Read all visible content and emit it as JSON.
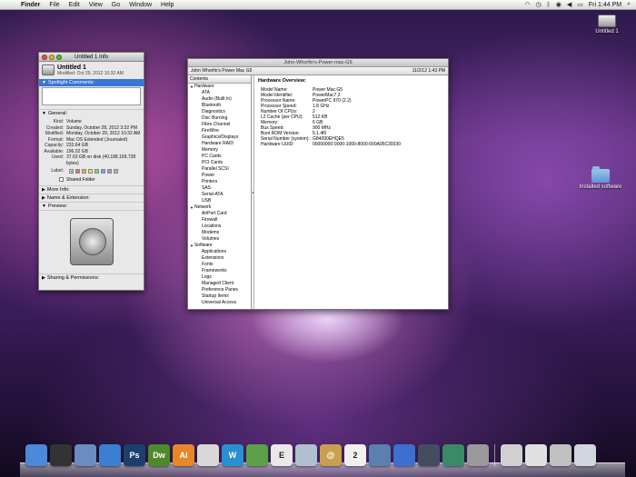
{
  "menubar": {
    "apple": "",
    "items": [
      "Finder",
      "File",
      "Edit",
      "View",
      "Go",
      "Window",
      "Help"
    ],
    "clock": "Fri 1:44 PM"
  },
  "desktop": {
    "icons": [
      {
        "label": "Untitled 1"
      },
      {
        "label": "Installed software"
      }
    ]
  },
  "info_window": {
    "title": "Untitled 1 Info",
    "name": "Untitled 1",
    "modified_line": "Modified: Oct 29, 2012 10:32 AM",
    "spotlight_label": "Spotlight Comments:",
    "general_label": "General:",
    "general": [
      {
        "k": "Kind:",
        "v": "Volume"
      },
      {
        "k": "Created:",
        "v": "Sunday, October 28, 2012 3:32 PM"
      },
      {
        "k": "Modified:",
        "v": "Monday, October 29, 2012 10:32 AM"
      },
      {
        "k": "Format:",
        "v": "Mac OS Extended (Journaled)"
      },
      {
        "k": "Capacity:",
        "v": "233.64 GB"
      },
      {
        "k": "Available:",
        "v": "196.02 GB"
      },
      {
        "k": "Used:",
        "v": "37.63 GB on disk (40,188,169,728 bytes)"
      }
    ],
    "label_label": "Label:",
    "label_colors": [
      "#ef6a5a",
      "#f6a33d",
      "#f4dc4a",
      "#8ed15a",
      "#6aa5ef",
      "#b88ae6",
      "#b0b0b0"
    ],
    "shared_folder": "Shared Folder",
    "more_info": "More Info:",
    "name_ext": "Name & Extension:",
    "preview": "Preview:",
    "sharing": "Sharing & Permissions:"
  },
  "profiler": {
    "title": "John-Whorfin's-Power-mac-G5",
    "subtitle_left": "John Whorfin's Power Mac G5",
    "subtitle_right": "11/2/12 1:43 PM",
    "sidebar_header": "Contents",
    "sections": [
      {
        "label": "Hardware",
        "items": [
          "ATA",
          "Audio (Built In)",
          "Bluetooth",
          "Diagnostics",
          "Disc Burning",
          "Fibre Channel",
          "FireWire",
          "Graphics/Displays",
          "Hardware RAID",
          "Memory",
          "PC Cards",
          "PCI Cards",
          "Parallel SCSI",
          "Power",
          "Printers",
          "SAS",
          "Serial-ATA",
          "USB"
        ]
      },
      {
        "label": "Network",
        "items": [
          "AirPort Card",
          "Firewall",
          "Locations",
          "Modems",
          "Volumes"
        ]
      },
      {
        "label": "Software",
        "items": [
          "Applications",
          "Extensions",
          "Fonts",
          "Frameworks",
          "Logs",
          "Managed Client",
          "Preference Panes",
          "Startup Items",
          "Universal Access"
        ]
      }
    ],
    "detail_title": "Hardware Overview:",
    "detail": [
      {
        "k": "Model Name:",
        "v": "Power Mac G5"
      },
      {
        "k": "Model Identifier:",
        "v": "PowerMac7,2"
      },
      {
        "k": "Processor Name:",
        "v": "PowerPC 970  (2.2)"
      },
      {
        "k": "Processor Speed:",
        "v": "1.8 GHz"
      },
      {
        "k": "Number Of CPUs:",
        "v": "2"
      },
      {
        "k": "L2 Cache (per CPU):",
        "v": "512 KB"
      },
      {
        "k": "Memory:",
        "v": "6 GB"
      },
      {
        "k": "Bus Speed:",
        "v": "900 MHz"
      },
      {
        "k": "Boot ROM Version:",
        "v": "5.1.4f0"
      },
      {
        "k": "Serial Number (system):",
        "v": "G84090EHQE5"
      },
      {
        "k": "Hardware UUID:",
        "v": "00000000-0000-1000-8000-000A95C39330"
      }
    ]
  },
  "dock": {
    "items": [
      {
        "name": "finder",
        "text": "",
        "color": "#4a8ad8"
      },
      {
        "name": "dashboard",
        "text": "",
        "color": "#333333"
      },
      {
        "name": "mail",
        "text": "",
        "color": "#6a8cc0"
      },
      {
        "name": "safari",
        "text": "",
        "color": "#3b7fd1"
      },
      {
        "name": "photoshop",
        "text": "Ps",
        "color": "#1c3f6e"
      },
      {
        "name": "dreamweaver",
        "text": "Dw",
        "color": "#4f8a2a"
      },
      {
        "name": "illustrator",
        "text": "Ai",
        "color": "#e8862a"
      },
      {
        "name": "acrobat",
        "text": "",
        "color": "#d8d8d8"
      },
      {
        "name": "app-w",
        "text": "W",
        "color": "#2a8fd1"
      },
      {
        "name": "app-x",
        "text": "",
        "color": "#5ca04a"
      },
      {
        "name": "app-e",
        "text": "E",
        "color": "#e8e8e8"
      },
      {
        "name": "app-mascot",
        "text": "",
        "color": "#b0c0d0"
      },
      {
        "name": "address-book",
        "text": "@",
        "color": "#c8a050"
      },
      {
        "name": "ical",
        "text": "2",
        "color": "#f0f0f0"
      },
      {
        "name": "iphoto",
        "text": "",
        "color": "#5a7fb0"
      },
      {
        "name": "itunes",
        "text": "",
        "color": "#3c6fd0"
      },
      {
        "name": "spaces",
        "text": "",
        "color": "#444c60"
      },
      {
        "name": "time-machine",
        "text": "",
        "color": "#3a8a6a"
      },
      {
        "name": "system-prefs",
        "text": "",
        "color": "#9a9a9a"
      },
      {
        "name": "sep",
        "text": "",
        "color": ""
      },
      {
        "name": "downloads",
        "text": "",
        "color": "#d0d0d0"
      },
      {
        "name": "documents",
        "text": "",
        "color": "#e0e0e0"
      },
      {
        "name": "stack",
        "text": "",
        "color": "#c0c0c0"
      },
      {
        "name": "trash",
        "text": "",
        "color": "#cfd6de"
      }
    ]
  }
}
